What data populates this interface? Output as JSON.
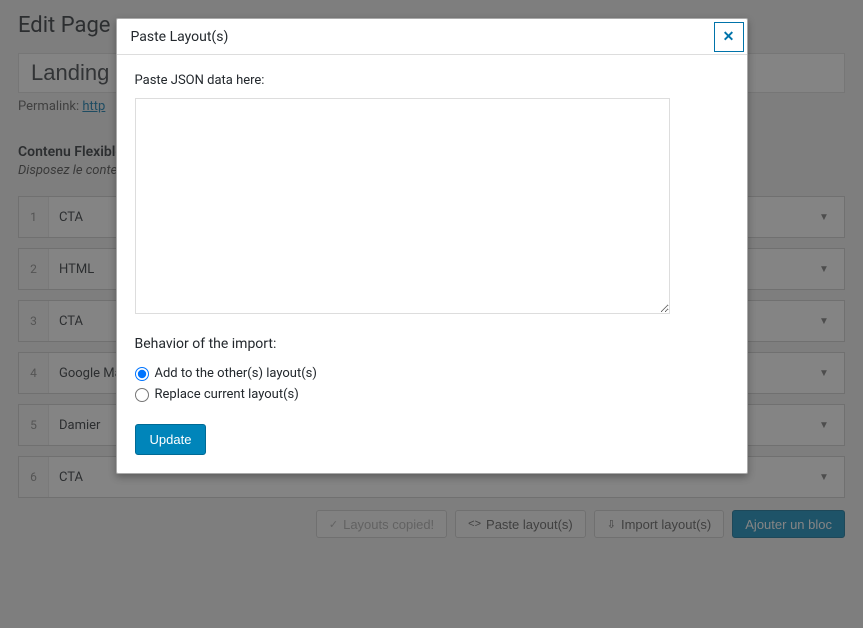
{
  "page": {
    "heading": "Edit Page",
    "title_value": "Landing p",
    "permalink_label": "Permalink:",
    "permalink_url": "http"
  },
  "flexible": {
    "title": "Contenu Flexible",
    "desc": "Disposez le conten",
    "rows": [
      {
        "idx": "1",
        "label": "CTA"
      },
      {
        "idx": "2",
        "label": "HTML"
      },
      {
        "idx": "3",
        "label": "CTA"
      },
      {
        "idx": "4",
        "label": "Google Ma"
      },
      {
        "idx": "5",
        "label": "Damier"
      },
      {
        "idx": "6",
        "label": "CTA"
      }
    ]
  },
  "footer": {
    "copied": "Layouts copied!",
    "paste": "Paste layout(s)",
    "import": "Import layout(s)",
    "add": "Ajouter un bloc"
  },
  "modal": {
    "title": "Paste Layout(s)",
    "label": "Paste JSON data here:",
    "behavior_title": "Behavior of the import:",
    "opt_add": "Add to the other(s) layout(s)",
    "opt_replace": "Replace current layout(s)",
    "update": "Update"
  }
}
